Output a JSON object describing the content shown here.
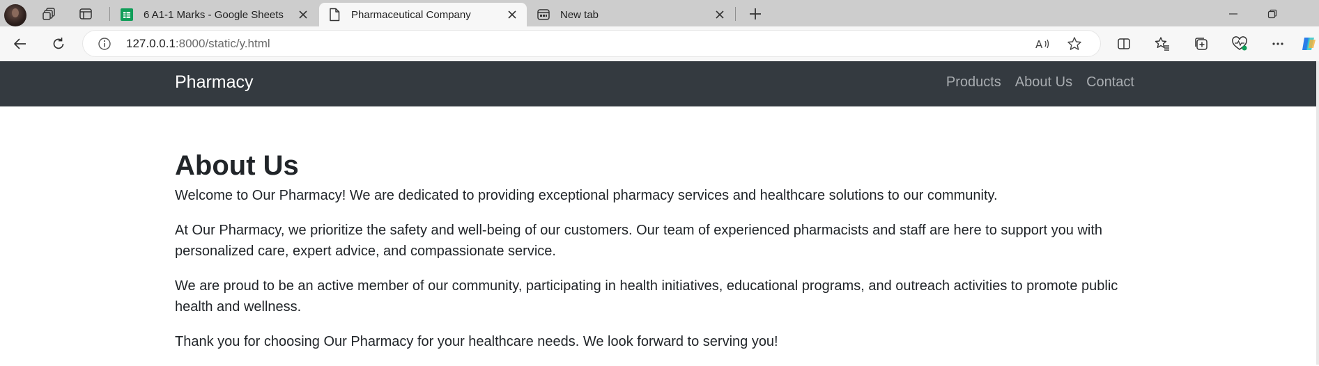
{
  "browser": {
    "tabs": [
      {
        "title": "6 A1-1 Marks - Google Sheets",
        "favicon": "sheets-icon",
        "active": false
      },
      {
        "title": "Pharmaceutical Company",
        "favicon": "page-icon",
        "active": true
      },
      {
        "title": "New tab",
        "favicon": "new-tab-icon",
        "active": false
      }
    ],
    "url_host": "127.0.0.1",
    "url_rest": ":8000/static/y.html",
    "accent_color": "#0f9d58"
  },
  "navbar": {
    "brand": "Pharmacy",
    "links": [
      "Products",
      "About Us",
      "Contact"
    ],
    "bg_color": "#343a40"
  },
  "main": {
    "heading": "About Us",
    "paragraphs": [
      "Welcome to Our Pharmacy! We are dedicated to providing exceptional pharmacy services and healthcare solutions to our community.",
      "At Our Pharmacy, we prioritize the safety and well-being of our customers. Our team of experienced pharmacists and staff are here to support you with personalized care, expert advice, and compassionate service.",
      "We are proud to be an active member of our community, participating in health initiatives, educational programs, and outreach activities to promote public health and wellness.",
      "Thank you for choosing Our Pharmacy for your healthcare needs. We look forward to serving you!"
    ]
  }
}
